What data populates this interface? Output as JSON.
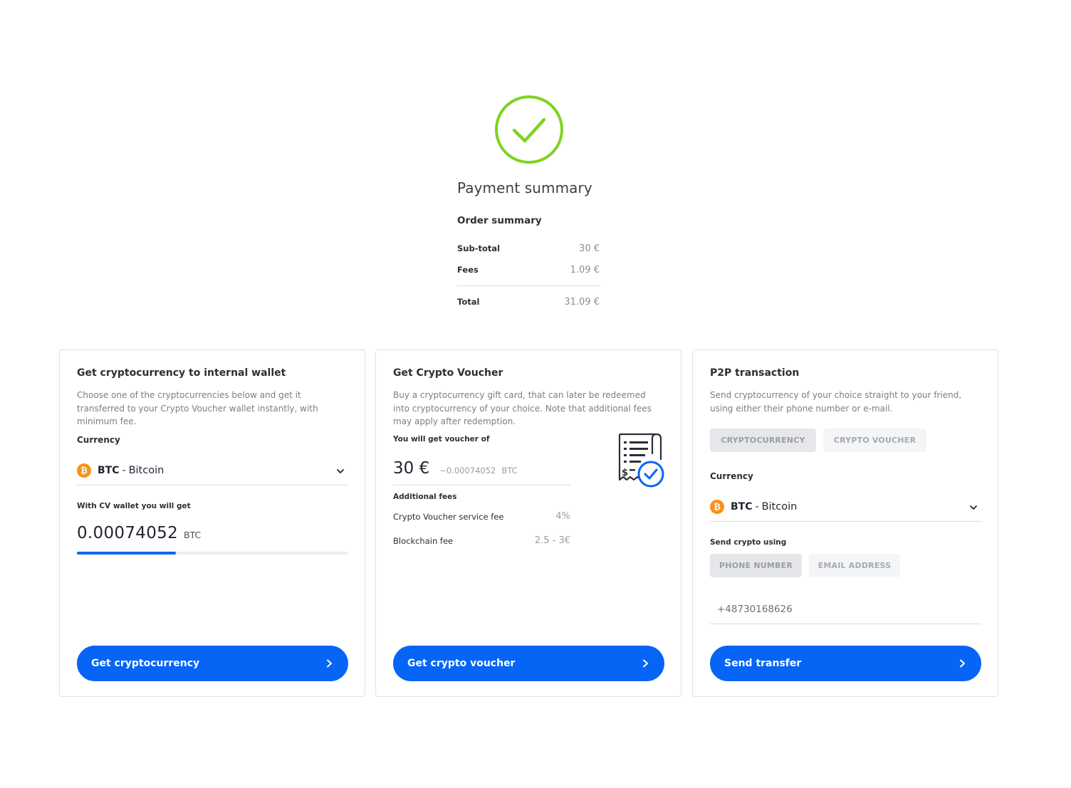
{
  "summary": {
    "title": "Payment summary",
    "subtitle": "Order summary",
    "rows": [
      {
        "label": "Sub-total",
        "value": "30 €"
      },
      {
        "label": "Fees",
        "value": "1.09 €"
      }
    ],
    "total": {
      "label": "Total",
      "value": "31.09 €"
    }
  },
  "colors": {
    "success_green": "#7ed321",
    "primary_blue": "#0665f5",
    "bitcoin_orange": "#f7931a"
  },
  "wallet_card": {
    "title": "Get cryptocurrency to internal wallet",
    "description": "Choose one of the cryptocurrencies below and get it transferred to your Crypto Voucher wallet instantly, with minimum fee.",
    "currency_label": "Currency",
    "currency": {
      "code": "BTC",
      "separator": "-",
      "name": "Bitcoin",
      "icon_glyph": "₿"
    },
    "receive_label": "With CV wallet you will get",
    "amount": "0.00074052",
    "unit": "BTC",
    "progress_fraction": 0.365,
    "button_label": "Get cryptocurrency"
  },
  "voucher_card": {
    "title": "Get Crypto Voucher",
    "description": "Buy a cryptocurrency gift card, that can later be redeemed into cryptocurrency of your choice. Note that additional fees may apply after redemption.",
    "voucher_label": "You will get voucher of",
    "amount": "30 €",
    "approx": "~0.00074052",
    "approx_unit": "BTC",
    "fees_label": "Additional fees",
    "fees": [
      {
        "label": "Crypto Voucher service fee",
        "value": "4%"
      },
      {
        "label": "Blockchain fee",
        "value": "2.5 - 3€"
      }
    ],
    "button_label": "Get crypto voucher"
  },
  "p2p_card": {
    "title": "P2P transaction",
    "description": "Send cryptocurrency of your choice straight to your friend, using either their phone number or e-mail.",
    "type_tabs": [
      "CRYPTOCURRENCY",
      "CRYPTO VOUCHER"
    ],
    "currency_label": "Currency",
    "currency": {
      "code": "BTC",
      "separator": "-",
      "name": "Bitcoin",
      "icon_glyph": "₿"
    },
    "send_using_label": "Send crypto using",
    "method_tabs": [
      "PHONE NUMBER",
      "EMAIL ADDRESS"
    ],
    "phone_value": "+48730168626",
    "button_label": "Send transfer"
  }
}
